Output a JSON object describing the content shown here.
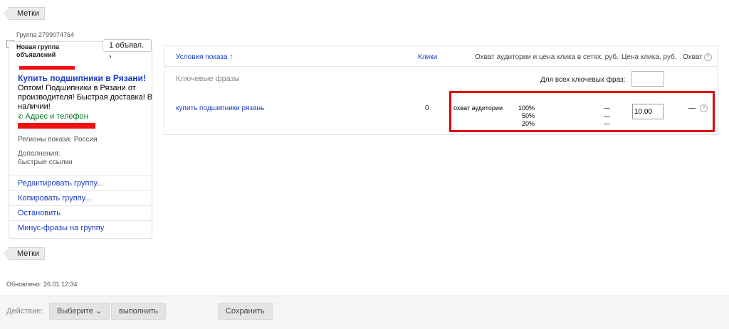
{
  "tags_top_label": "Метки",
  "tags_bottom_label": "Метки",
  "group": {
    "id_label": "Группа 2799074764",
    "name": "Новая группа объявлений",
    "ads_count": "1 объявл.",
    "ad_title": "Купить подшипники в Рязани!",
    "ad_text": "Оптом! Подшипники в Рязани от производителя! Быстрая доставка! В наличии!",
    "address_link": "Адрес и телефон",
    "regions": "Регионы показа: Россия",
    "extras_label": "Дополнения:",
    "extras_value": "быстрые ссылки",
    "actions": [
      "Редактировать группу...",
      "Копировать группу...",
      "Остановить",
      "Минус-фразы на группу"
    ]
  },
  "table": {
    "headers": {
      "conditions": "Условия показа",
      "clicks": "Клики",
      "reach_networks": "Охват аудитории и цена клика в сетях, руб.",
      "price": "Цена клика, руб.",
      "reach": "Охват"
    },
    "keyphrases_label": "Ключевые фразы",
    "all_phrases_label": "Для всех ключевых фраз:",
    "all_phrases_value": "",
    "row": {
      "phrase": "купить подшипники рязань",
      "clicks": "0",
      "reach_label": "охват аудитории",
      "reach_levels": [
        "100%",
        "50%",
        "20%"
      ],
      "reach_values": [
        "—",
        "—",
        "—"
      ],
      "price": "10.00",
      "reach": "—"
    }
  },
  "updated": "Обновлено: 26.01 12:34",
  "bottom_bar": {
    "action_label": "Действие:",
    "select_label": "Выберите",
    "run_label": "выполнить",
    "save_label": "Сохранить"
  }
}
